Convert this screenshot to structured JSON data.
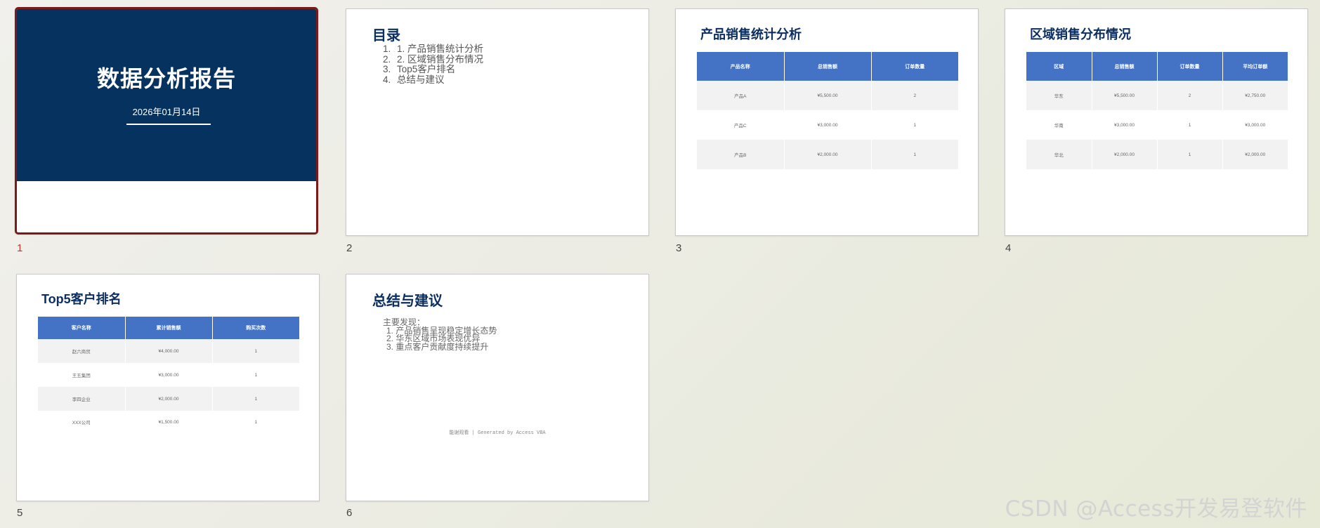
{
  "slides": [
    {
      "number": "1",
      "title": "数据分析报告",
      "date": "2026年01月14日"
    },
    {
      "number": "2",
      "title": "目录",
      "items": [
        {
          "n": "1.",
          "text": "1.   产品销售统计分析"
        },
        {
          "n": "2.",
          "text": "2.   区域销售分布情况"
        },
        {
          "n": "3.",
          "text": "Top5客户排名"
        },
        {
          "n": "4.",
          "text": "总结与建议"
        }
      ]
    },
    {
      "number": "3",
      "title": "产品销售统计分析",
      "columns": [
        "产品名称",
        "总销售额",
        "订单数量"
      ],
      "rows": [
        [
          "产品A",
          "¥5,500.00",
          "2"
        ],
        [
          "产品C",
          "¥3,000.00",
          "1"
        ],
        [
          "产品B",
          "¥2,000.00",
          "1"
        ]
      ]
    },
    {
      "number": "4",
      "title": "区域销售分布情况",
      "columns": [
        "区域",
        "总销售额",
        "订单数量",
        "平均订单额"
      ],
      "rows": [
        [
          "华东",
          "¥5,500.00",
          "2",
          "¥2,750.00"
        ],
        [
          "华南",
          "¥3,000.00",
          "1",
          "¥3,000.00"
        ],
        [
          "华北",
          "¥2,000.00",
          "1",
          "¥2,000.00"
        ]
      ]
    },
    {
      "number": "5",
      "title": "Top5客户排名",
      "columns": [
        "客户名称",
        "累计销售额",
        "购买次数"
      ],
      "rows": [
        [
          "赵六商贸",
          "¥4,000.00",
          "1"
        ],
        [
          "王五集团",
          "¥3,000.00",
          "1"
        ],
        [
          "李四企业",
          "¥2,000.00",
          "1"
        ],
        [
          "XXX公司",
          "¥1,500.00",
          "1"
        ]
      ]
    },
    {
      "number": "6",
      "title": "总结与建议",
      "intro": "主要发现：",
      "findings": [
        "1. 产品销售呈现稳定增长态势",
        "2. 华东区域市场表现优异",
        "3. 重点客户贡献度持续提升"
      ],
      "footer": "能谢观看 | Generated by Access VBA"
    }
  ],
  "watermark": "CSDN @Access开发易登软件",
  "colors": {
    "title_band": "#05325f",
    "table_header": "#4472c4",
    "heading": "#0b2f61",
    "selected_border": "#7a1a1a"
  }
}
